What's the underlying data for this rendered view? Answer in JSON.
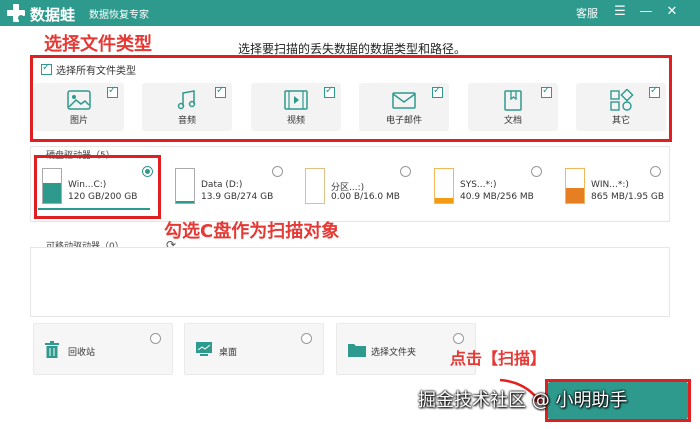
{
  "titlebar": {
    "brand": "数据蛙",
    "tagline": "数据恢复专家",
    "service": "客服",
    "menu_glyph": "☰",
    "minimize_glyph": "—",
    "close_glyph": "✕"
  },
  "annotations": {
    "choose_types": "选择文件类型",
    "check_c": "勾选C盘作为扫描对象",
    "click_scan": "点击【扫描】"
  },
  "instruction": "选择要扫描的丢失数据的数据类型和路径。",
  "file_types": {
    "select_all_label": "选择所有文件类型",
    "items": [
      {
        "key": "image",
        "label": "图片",
        "icon": "image-icon",
        "checked": true
      },
      {
        "key": "audio",
        "label": "音频",
        "icon": "music-icon",
        "checked": true
      },
      {
        "key": "video",
        "label": "视频",
        "icon": "video-icon",
        "checked": true
      },
      {
        "key": "email",
        "label": "电子邮件",
        "icon": "mail-icon",
        "checked": true
      },
      {
        "key": "document",
        "label": "文档",
        "icon": "document-icon",
        "checked": true
      },
      {
        "key": "other",
        "label": "其它",
        "icon": "grid-icon",
        "checked": true
      }
    ]
  },
  "drives": {
    "title": "硬盘驱动器（5）",
    "items": [
      {
        "name": "Win...C:)",
        "size": "120 GB/200 GB",
        "selected": true,
        "fill_color": "#2e9a8e",
        "fill_ratio": 0.6
      },
      {
        "name": "Data (D:)",
        "size": "13.9 GB/274 GB",
        "selected": false,
        "fill_color": "#2e9a8e",
        "fill_ratio": 0.05
      },
      {
        "name": "分区...:)",
        "size": "0.00  B/16.0 MB",
        "selected": false,
        "fill_color": "#e8c07a",
        "fill_ratio": 0.0
      },
      {
        "name": "SYS...*:)",
        "size": "40.9 MB/256 MB",
        "selected": false,
        "fill_color": "#f39c12",
        "fill_ratio": 0.16
      },
      {
        "name": "WIN...*:)",
        "size": "865 MB/1.95 GB",
        "selected": false,
        "fill_color": "#e67e22",
        "fill_ratio": 0.43
      }
    ]
  },
  "removable": {
    "title": "可移动驱动器（0）"
  },
  "quick_locations": [
    {
      "label": "回收站",
      "icon": "trash-icon"
    },
    {
      "label": "桌面",
      "icon": "desktop-icon"
    },
    {
      "label": "选择文件夹",
      "icon": "folder-icon"
    }
  ],
  "watermark": "掘金技术社区 @ 小明助手",
  "colors": {
    "accent": "#2e9a8e",
    "annotation": "#e53935"
  }
}
